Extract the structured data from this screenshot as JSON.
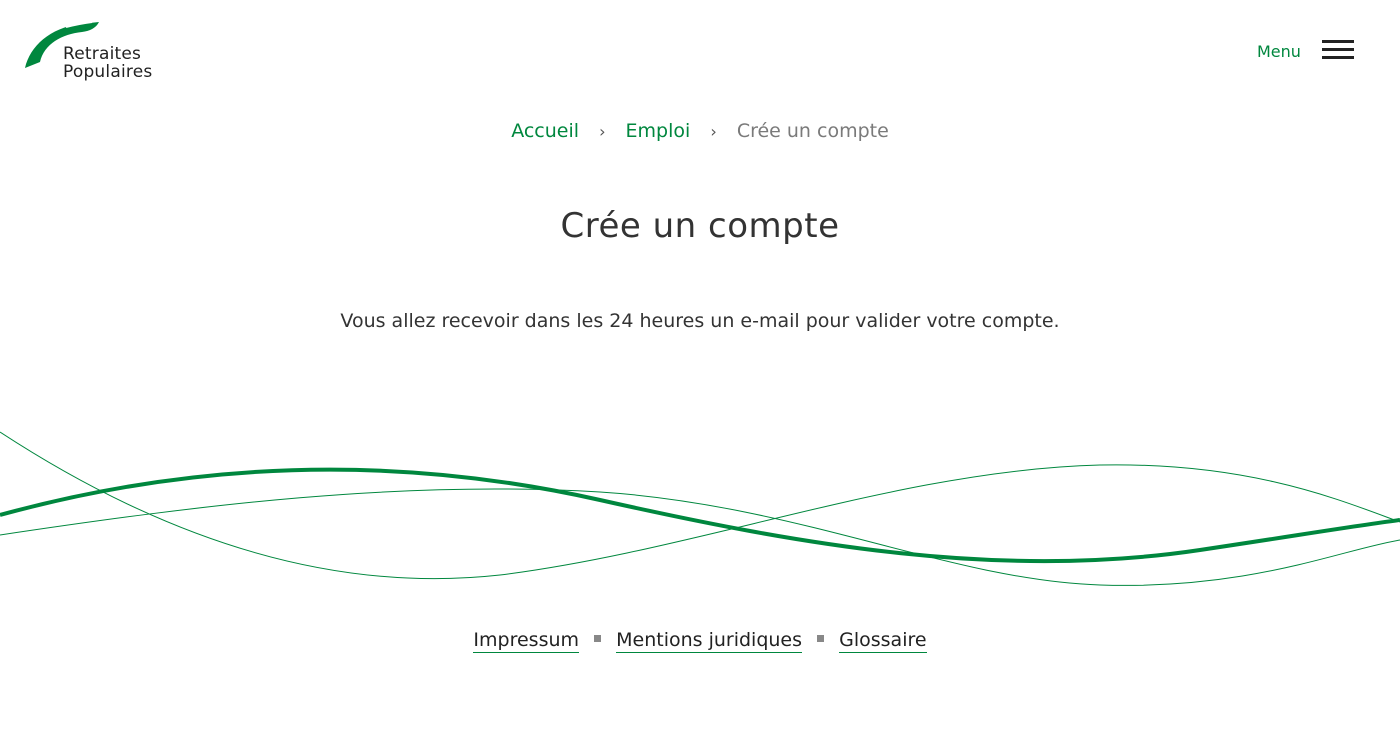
{
  "header": {
    "logo": {
      "line1": "Retraites",
      "line2": "Populaires",
      "brand_color": "#00873e"
    },
    "menu_label": "Menu",
    "menu_icon": "hamburger-icon"
  },
  "breadcrumb": {
    "items": [
      {
        "label": "Accueil"
      },
      {
        "label": "Emploi"
      },
      {
        "label": "Crée un compte"
      }
    ],
    "separator": "›"
  },
  "main": {
    "title": "Crée un compte",
    "message": "Vous allez recevoir dans les 24 heures un e-mail pour valider votre compte."
  },
  "footer": {
    "links": [
      {
        "label": "Impressum"
      },
      {
        "label": "Mentions juridiques"
      },
      {
        "label": "Glossaire"
      }
    ]
  },
  "colors": {
    "accent": "#00873e",
    "text": "#333333",
    "muted": "#7a7a7a"
  }
}
